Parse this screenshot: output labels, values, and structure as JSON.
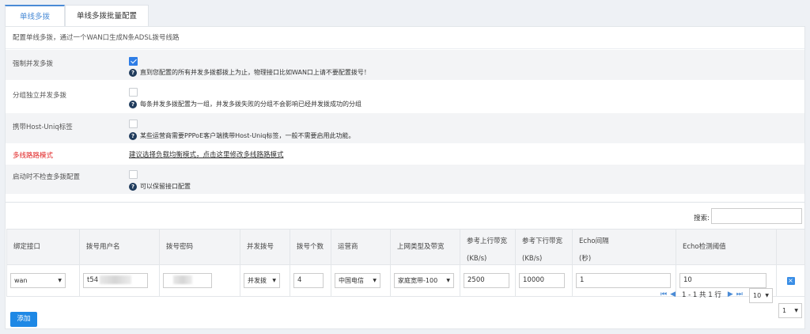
{
  "tabs": [
    {
      "label": "单线多拨"
    },
    {
      "label": "单线多拨批量配置"
    }
  ],
  "description": "配置单线多拨，通过一个WAN口生成N条ADSL拨号线路",
  "settings": [
    {
      "label": "强制并发多拨",
      "checked": true,
      "hint": "直到您配置的所有并发多拨都拨上为止，物理接口比如WAN口上请不要配置拨号！"
    },
    {
      "label": "分组独立并发多拨",
      "checked": false,
      "hint": "每条并发多拨配置为一组，并发多拨失败的分组不会影响已经并发拨成功的分组"
    },
    {
      "label": "携带Host-Uniq标签",
      "checked": false,
      "hint": "某些运营商需要PPPoE客户端携带Host-Uniq标签，一般不需要启用此功能。"
    },
    {
      "label": "多线路路模式",
      "link": "建议选择负载均衡模式，点击这里修改多线路路模式"
    },
    {
      "label": "启动时不检查多拨配置",
      "checked": false,
      "hint": "可以保留接口配置"
    }
  ],
  "search": {
    "label": "搜索:",
    "value": ""
  },
  "table": {
    "headers": [
      {
        "l1": "绑定接口",
        "l2": ""
      },
      {
        "l1": "拨号用户名",
        "l2": ""
      },
      {
        "l1": "拨号密码",
        "l2": ""
      },
      {
        "l1": "并发拨号",
        "l2": ""
      },
      {
        "l1": "拨号个数",
        "l2": ""
      },
      {
        "l1": "运营商",
        "l2": ""
      },
      {
        "l1": "上网类型及带宽",
        "l2": ""
      },
      {
        "l1": "参考上行带宽",
        "l2": "(KB/s)"
      },
      {
        "l1": "参考下行带宽",
        "l2": "(KB/s)"
      },
      {
        "l1": "Echo间隔",
        "l2": "(秒)"
      },
      {
        "l1": "Echo检测阈值",
        "l2": ""
      },
      {
        "l1": "",
        "l2": ""
      }
    ],
    "row": {
      "interface": "wan",
      "username": "t54",
      "password": "",
      "concurrent": "并发拨",
      "count": "4",
      "isp": "中国电信",
      "net_type": "家庭宽带-100",
      "up_bw": "2500",
      "down_bw": "10000",
      "echo_interval": "1",
      "echo_threshold": "10",
      "delete_glyph": "×"
    }
  },
  "pager": {
    "text": "1 - 1 共 1 行",
    "page_size": "10",
    "page": "1"
  },
  "add_button": "添加",
  "colors": {
    "accent": "#1e88e5",
    "warning_label": "#e02020"
  }
}
